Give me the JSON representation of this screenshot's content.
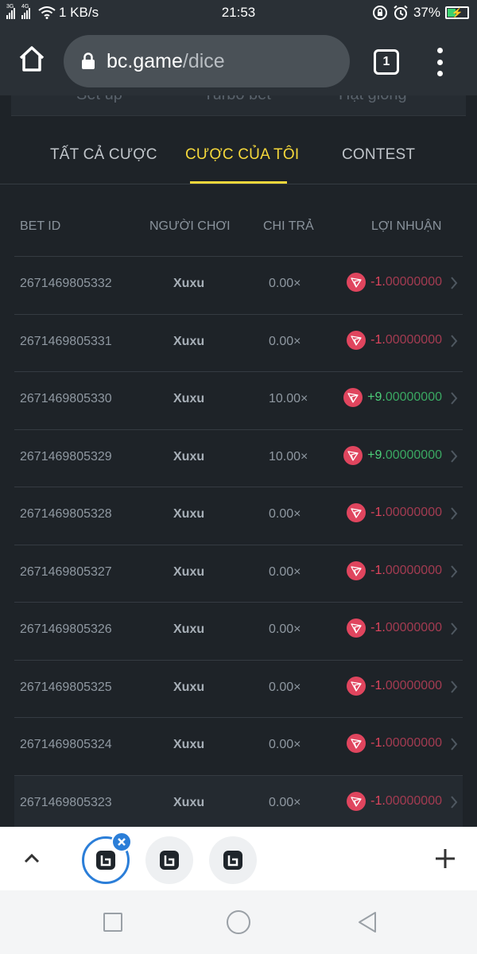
{
  "status_bar": {
    "net_left": "3G",
    "net_right": "4G",
    "speed": "1 KB/s",
    "time": "21:53",
    "battery": "37%"
  },
  "browser": {
    "url_domain": "bc.game",
    "url_path": "/dice",
    "tab_count": "1"
  },
  "subtabs": [
    "Set up",
    "Turbo bet",
    "Hạt giống"
  ],
  "tabs": {
    "all_bets": "TẤT CẢ CƯỢC",
    "my_bets": "CƯỢC CỦA TÔI",
    "contest": "CONTEST"
  },
  "table": {
    "headers": {
      "bet_id": "BET ID",
      "player": "NGƯỜI CHƠI",
      "payout": "CHI TRẢ",
      "profit": "LỢI NHUẬN"
    },
    "rows": [
      {
        "bet_id": "2671469805332",
        "player": "Xuxu",
        "payout": "0.00×",
        "profit_int": "-1.",
        "profit_dec": "00000000",
        "sign": "neg"
      },
      {
        "bet_id": "2671469805331",
        "player": "Xuxu",
        "payout": "0.00×",
        "profit_int": "-1.",
        "profit_dec": "00000000",
        "sign": "neg"
      },
      {
        "bet_id": "2671469805330",
        "player": "Xuxu",
        "payout": "10.00×",
        "profit_int": "+9.",
        "profit_dec": "00000000",
        "sign": "pos"
      },
      {
        "bet_id": "2671469805329",
        "player": "Xuxu",
        "payout": "10.00×",
        "profit_int": "+9.",
        "profit_dec": "00000000",
        "sign": "pos"
      },
      {
        "bet_id": "2671469805328",
        "player": "Xuxu",
        "payout": "0.00×",
        "profit_int": "-1.",
        "profit_dec": "00000000",
        "sign": "neg"
      },
      {
        "bet_id": "2671469805327",
        "player": "Xuxu",
        "payout": "0.00×",
        "profit_int": "-1.",
        "profit_dec": "00000000",
        "sign": "neg"
      },
      {
        "bet_id": "2671469805326",
        "player": "Xuxu",
        "payout": "0.00×",
        "profit_int": "-1.",
        "profit_dec": "00000000",
        "sign": "neg"
      },
      {
        "bet_id": "2671469805325",
        "player": "Xuxu",
        "payout": "0.00×",
        "profit_int": "-1.",
        "profit_dec": "00000000",
        "sign": "neg"
      },
      {
        "bet_id": "2671469805324",
        "player": "Xuxu",
        "payout": "0.00×",
        "profit_int": "-1.",
        "profit_dec": "00000000",
        "sign": "neg"
      },
      {
        "bet_id": "2671469805323",
        "player": "Xuxu",
        "payout": "0.00×",
        "profit_int": "-1.",
        "profit_dec": "00000000",
        "sign": "neg"
      }
    ]
  },
  "icons": {
    "currency": "tron-icon",
    "row_action": "chevron-right-icon"
  },
  "colors": {
    "accent": "#f5d83b",
    "loss": "#e0455e",
    "win": "#4dd07a",
    "background": "#1e2328",
    "active_tab_ring": "#2b7ed8"
  }
}
